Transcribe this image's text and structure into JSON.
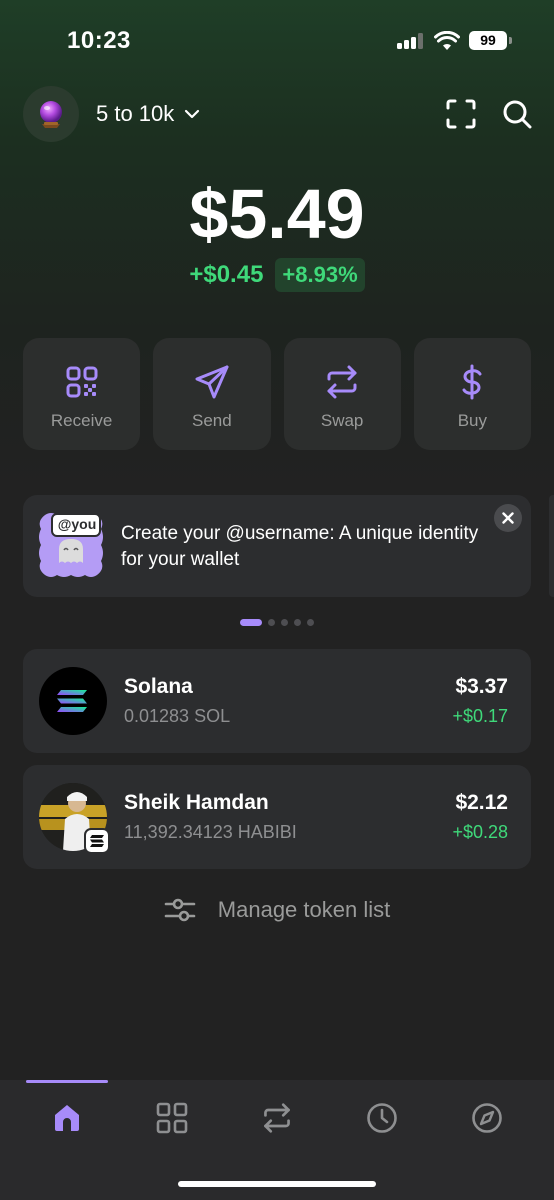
{
  "status_bar": {
    "time": "10:23",
    "battery": "99"
  },
  "header": {
    "account_name": "5 to 10k",
    "avatar_icon": "crystal-ball-icon",
    "scan_icon": "scan-icon",
    "search_icon": "search-icon"
  },
  "balance": {
    "total": "$5.49",
    "change_abs": "+$0.45",
    "change_pct": "+8.93%"
  },
  "actions": [
    {
      "label": "Receive",
      "icon": "qr-code-icon"
    },
    {
      "label": "Send",
      "icon": "send-icon"
    },
    {
      "label": "Swap",
      "icon": "swap-icon"
    },
    {
      "label": "Buy",
      "icon": "dollar-icon"
    }
  ],
  "banner": {
    "tag": "@you",
    "text": "Create your @username: A unique identity for your wallet",
    "pages": 5,
    "active_page": 1
  },
  "tokens": [
    {
      "name": "Solana",
      "amount": "0.01283 SOL",
      "value": "$3.37",
      "change": "+$0.17"
    },
    {
      "name": "Sheik Hamdan",
      "amount": "11,392.34123 HABIBI",
      "value": "$2.12",
      "change": "+$0.28"
    }
  ],
  "manage_label": "Manage token list",
  "nav": [
    {
      "icon": "home-icon",
      "active": true
    },
    {
      "icon": "collectibles-grid-icon",
      "active": false
    },
    {
      "icon": "swap-icon",
      "active": false
    },
    {
      "icon": "activity-clock-icon",
      "active": false
    },
    {
      "icon": "explore-compass-icon",
      "active": false
    }
  ],
  "colors": {
    "accent": "#a78bfa",
    "positive": "#3fd97a",
    "card": "#2c2d2f"
  }
}
